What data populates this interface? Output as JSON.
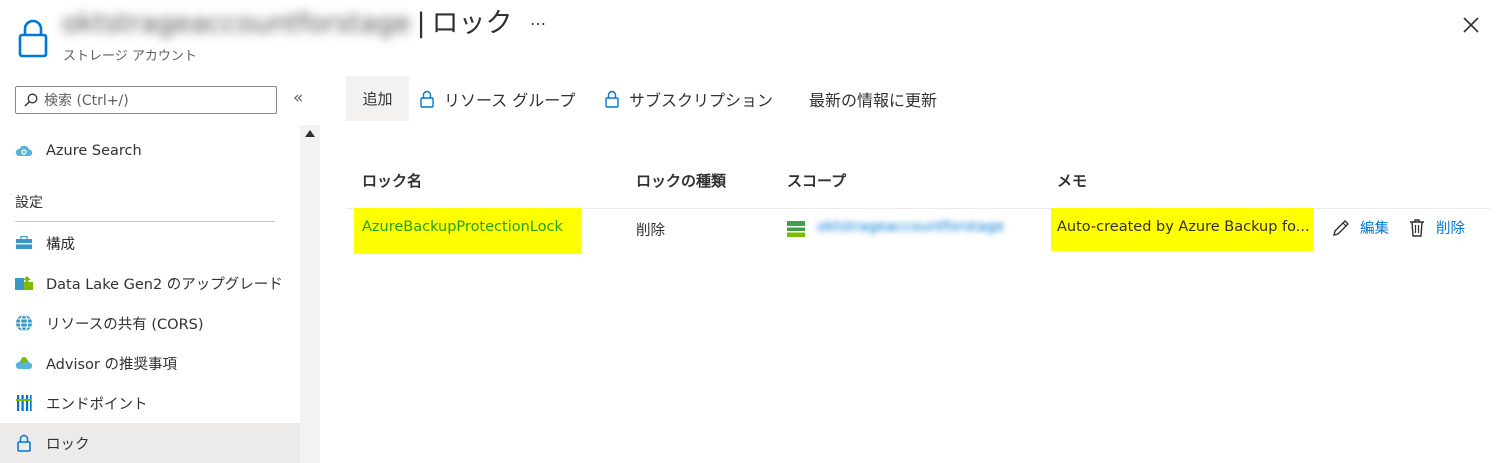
{
  "header": {
    "resource_name": "oktstrageaccountforstage",
    "separator": "|",
    "page_name": "ロック",
    "subtitle": "ストレージ アカウント",
    "more_label": "…",
    "icons": {
      "resource": "lock-icon",
      "close": "close-icon"
    }
  },
  "sidebar": {
    "search_placeholder": "検索 (Ctrl+/)",
    "collapse_label": "«",
    "items_top": [
      {
        "label": "Azure Search",
        "icon": "cloud-search-icon"
      }
    ],
    "section_title": "設定",
    "items": [
      {
        "label": "構成",
        "icon": "toolbox-icon"
      },
      {
        "label": "Data Lake Gen2 のアップグレード",
        "icon": "upgrade-icon"
      },
      {
        "label": "リソースの共有 (CORS)",
        "icon": "cors-icon"
      },
      {
        "label": "Advisor の推奨事項",
        "icon": "advisor-icon"
      },
      {
        "label": "エンドポイント",
        "icon": "endpoint-icon"
      },
      {
        "label": "ロック",
        "icon": "lock-icon",
        "active": true
      }
    ]
  },
  "toolbar": {
    "add": "追加",
    "resource_group": "リソース グループ",
    "subscription": "サブスクリプション",
    "refresh": "最新の情報に更新"
  },
  "table": {
    "headers": {
      "name": "ロック名",
      "type": "ロックの種類",
      "scope": "スコープ",
      "memo": "メモ"
    },
    "rows": [
      {
        "name": "AzureBackupProtectionLock",
        "type": "削除",
        "scope": "oktstrageaccountforstage",
        "memo": "Auto-created by Azure Backup fo...",
        "edit": "編集",
        "delete": "削除"
      }
    ]
  },
  "colors": {
    "accent": "#0078d4",
    "highlight": "#ffff00",
    "lock_name_text": "#23a014"
  }
}
